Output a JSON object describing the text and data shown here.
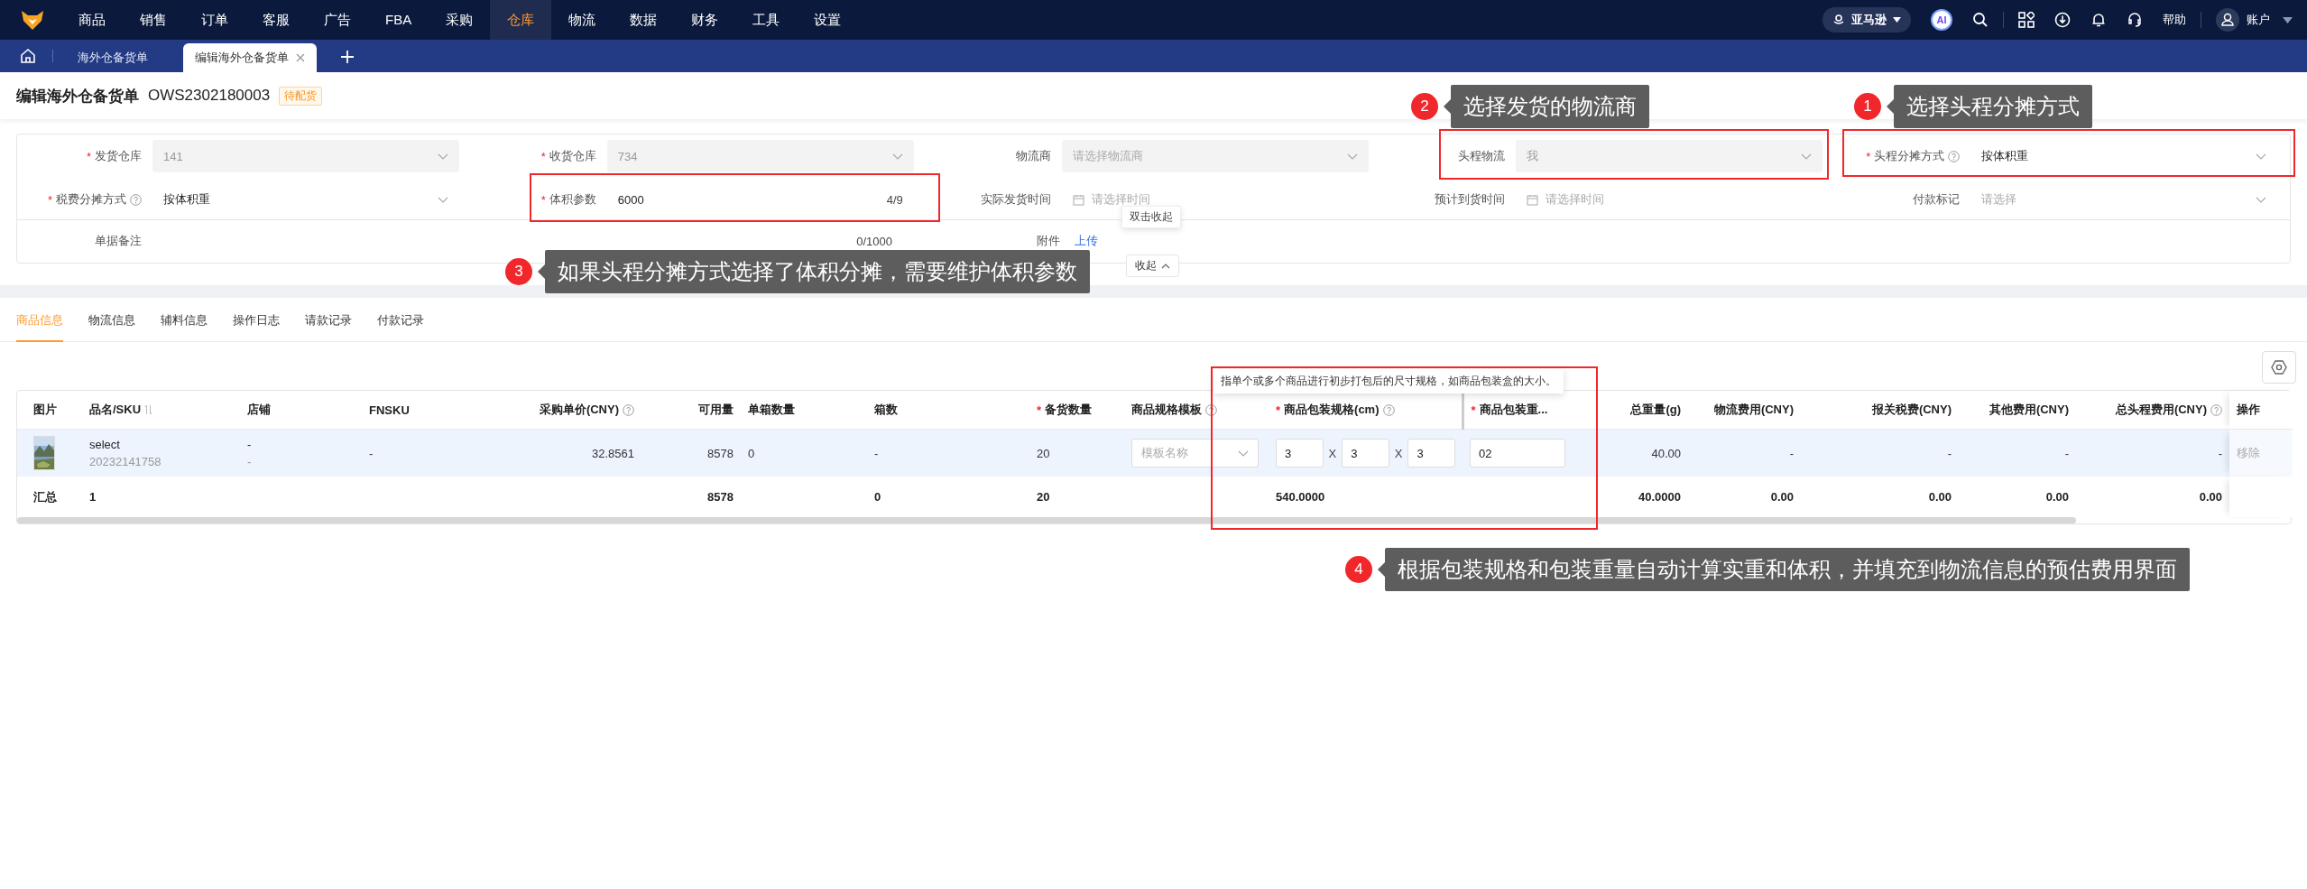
{
  "nav": {
    "items": [
      {
        "label": "商品",
        "selected": false
      },
      {
        "label": "销售",
        "selected": false
      },
      {
        "label": "订单",
        "selected": false
      },
      {
        "label": "客服",
        "selected": false
      },
      {
        "label": "广告",
        "selected": false
      },
      {
        "label": "FBA",
        "selected": false
      },
      {
        "label": "采购",
        "selected": false
      },
      {
        "label": "仓库",
        "selected": true
      },
      {
        "label": "物流",
        "selected": false
      },
      {
        "label": "数据",
        "selected": false
      },
      {
        "label": "财务",
        "selected": false
      },
      {
        "label": "工具",
        "selected": false
      },
      {
        "label": "设置",
        "selected": false
      }
    ],
    "platform": "亚马逊",
    "ai": "AI",
    "help": "帮助",
    "account": "账户"
  },
  "page_tabs": [
    {
      "label": "海外仓备货单",
      "selected": false
    },
    {
      "label": "编辑海外仓备货单",
      "selected": true
    }
  ],
  "header": {
    "title": "编辑海外仓备货单",
    "order_no": "OWS2302180003",
    "status": "待配货"
  },
  "form": {
    "fields": [
      {
        "label": "发货仓库",
        "required_mark": "*",
        "kind": "select",
        "value": "141",
        "disabled": true
      },
      {
        "label": "收货仓库",
        "required_mark": "*",
        "kind": "select",
        "value": "734",
        "disabled": true
      },
      {
        "label": "物流商",
        "kind": "select",
        "placeholder": "请选择物流商",
        "disabled": true
      },
      {
        "label": "头程物流",
        "kind": "select",
        "value": "我",
        "disabled": true
      },
      {
        "label": "头程分摊方式",
        "required_mark": "*",
        "help": true,
        "kind": "select",
        "value": "按体积重",
        "disabled": false
      },
      {
        "label": "税费分摊方式",
        "required_mark": "*",
        "help": true,
        "kind": "select",
        "value": "按体积重",
        "disabled": false
      },
      {
        "label": "体积参数",
        "required_mark": "*",
        "kind": "input",
        "value": "6000",
        "counter": "4/9",
        "disabled": false
      },
      {
        "label": "实际发货时间",
        "kind": "date",
        "placeholder": "请选择时间",
        "disabled": false
      },
      {
        "label": "预计到货时间",
        "kind": "date",
        "placeholder": "请选择时间",
        "disabled": false
      },
      {
        "label": "付款标记",
        "kind": "select",
        "placeholder": "请选择",
        "disabled": false
      }
    ],
    "remark": {
      "label": "单据备注",
      "counter": "0/1000"
    },
    "attachment": {
      "label": "附件",
      "link": "上传"
    },
    "collapse": {
      "label": "收起",
      "tooltip": "双击收起"
    }
  },
  "detail_tabs": [
    {
      "label": "商品信息",
      "selected": true
    },
    {
      "label": "物流信息",
      "selected": false
    },
    {
      "label": "辅料信息",
      "selected": false
    },
    {
      "label": "操作日志",
      "selected": false
    },
    {
      "label": "请款记录",
      "selected": false
    },
    {
      "label": "付款记录",
      "selected": false
    }
  ],
  "table": {
    "columns": [
      {
        "label": "图片",
        "total": "汇总"
      },
      {
        "label": "品名/SKU",
        "sortable": true,
        "total": "1"
      },
      {
        "label": "店铺"
      },
      {
        "label": "FNSKU"
      },
      {
        "label": "采购单价(CNY)",
        "help": true
      },
      {
        "label": "可用量",
        "total": "8578"
      },
      {
        "label": "单箱数量"
      },
      {
        "label": "箱数",
        "total": "0"
      },
      {
        "label": "备货数量",
        "required_mark": "*",
        "total": "20"
      },
      {
        "label": "商品规格模板",
        "help": true
      },
      {
        "label": "商品包装规格(cm)",
        "required_mark": "*",
        "help": true,
        "total": "540.0000"
      },
      {
        "label": "商品包装重...",
        "required_mark": "*"
      },
      {
        "label": "总重量(g)",
        "total": "40.0000"
      },
      {
        "label": "物流费用(CNY)",
        "total": "0.00"
      },
      {
        "label": "报关税费(CNY)",
        "total": "0.00"
      },
      {
        "label": "其他费用(CNY)",
        "total": "0.00"
      },
      {
        "label": "总头程费用(CNY)",
        "help": true,
        "total": "0.00"
      },
      {
        "label": "操作"
      }
    ],
    "rows": [
      {
        "cells": [
          {
            "kind": "picture"
          },
          {
            "kind": "stack",
            "text": "select",
            "sub": "20232141758"
          },
          {
            "kind": "stack",
            "text": "-",
            "sub": "-"
          },
          {
            "kind": "text",
            "text": "-"
          },
          {
            "kind": "text",
            "text": "32.8561"
          },
          {
            "kind": "text",
            "text": "8578"
          },
          {
            "kind": "text",
            "text": "0"
          },
          {
            "kind": "text",
            "text": "-"
          },
          {
            "kind": "text",
            "text": "20"
          },
          {
            "kind": "select",
            "placeholder": "模板名称"
          },
          {
            "kind": "dims",
            "values": [
              "3",
              "3",
              "3"
            ],
            "seps": [
              "X",
              "X"
            ]
          },
          {
            "kind": "input",
            "value": "02"
          },
          {
            "kind": "text",
            "text": "40.00"
          },
          {
            "kind": "text",
            "text": "-"
          },
          {
            "kind": "text",
            "text": "-"
          },
          {
            "kind": "text",
            "text": "-"
          },
          {
            "kind": "text",
            "text": "-"
          },
          {
            "kind": "link",
            "text": "移除",
            "disabled": true
          }
        ]
      }
    ],
    "help_tooltip": "指单个或多个商品进行初步打包后的尺寸规格，如商品包装盒的大小。"
  },
  "annotations": [
    {
      "number": "2",
      "text": "选择发货的物流商"
    },
    {
      "number": "1",
      "text": "选择头程分摊方式"
    },
    {
      "number": "3",
      "text": "如果头程分摊方式选择了体积分摊，需要维护体积参数"
    },
    {
      "number": "4",
      "text": "根据包装规格和包装重量自动计算实重和体积，并填充到物流信息的预估费用界面"
    }
  ]
}
